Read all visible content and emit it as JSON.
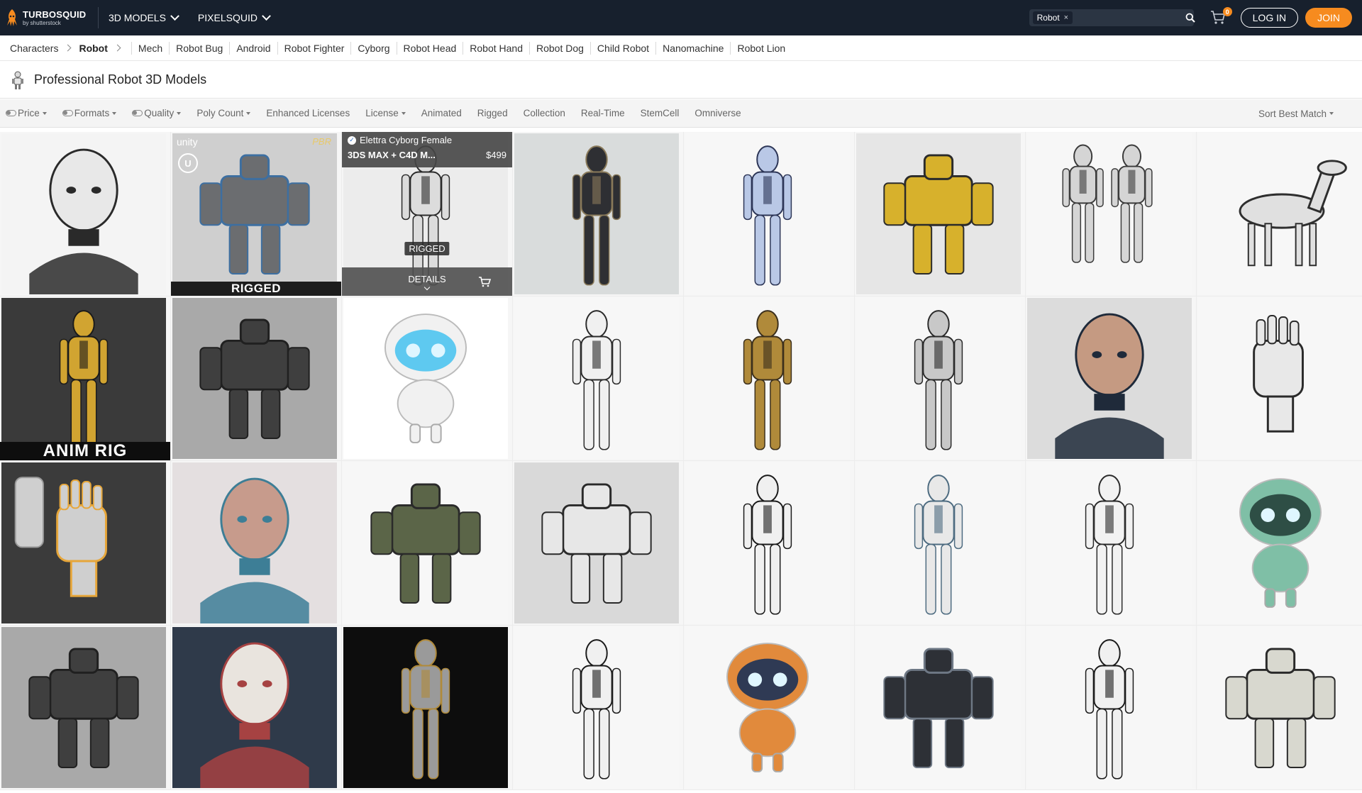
{
  "nav": {
    "logo_name": "TURBOSQUID",
    "logo_sub": "by shutterstock",
    "menus": [
      {
        "label": "3D MODELS"
      },
      {
        "label": "PIXELSQUID"
      }
    ],
    "search_chip": "Robot",
    "search_chip_close": "×",
    "search_placeholder": "",
    "cart_count": "0",
    "login_label": "LOG IN",
    "join_label": "JOIN",
    "colors": {
      "bar": "#17202d",
      "accent": "#f68b1f"
    }
  },
  "breadcrumb": {
    "items": [
      "Characters",
      "Robot"
    ],
    "related": [
      "Mech",
      "Robot Bug",
      "Android",
      "Robot Fighter",
      "Cyborg",
      "Robot Head",
      "Robot Hand",
      "Robot Dog",
      "Child Robot",
      "Nanomachine",
      "Robot Lion"
    ]
  },
  "page": {
    "title": "Professional Robot 3D Models"
  },
  "filters": {
    "items": [
      {
        "label": "Price",
        "toggle": true,
        "dropdown": true
      },
      {
        "label": "Formats",
        "toggle": true,
        "dropdown": true
      },
      {
        "label": "Quality",
        "toggle": true,
        "dropdown": true
      },
      {
        "label": "Poly Count",
        "toggle": false,
        "dropdown": true
      },
      {
        "label": "Enhanced Licenses",
        "toggle": false,
        "dropdown": false
      },
      {
        "label": "License",
        "toggle": false,
        "dropdown": true
      },
      {
        "label": "Animated",
        "toggle": false,
        "dropdown": false
      },
      {
        "label": "Rigged",
        "toggle": false,
        "dropdown": false
      },
      {
        "label": "Collection",
        "toggle": false,
        "dropdown": false
      },
      {
        "label": "Real-Time",
        "toggle": false,
        "dropdown": false
      },
      {
        "label": "StemCell",
        "toggle": false,
        "dropdown": false
      },
      {
        "label": "Omniverse",
        "toggle": false,
        "dropdown": false
      }
    ],
    "sort_label": "Sort Best Match"
  },
  "results": {
    "badges": {
      "rigged": "RIGGED",
      "anim_rig": "ANIM RIG",
      "unity": "unity",
      "pbr": "PBR",
      "unreal": "U"
    },
    "hover_card": {
      "name": "Elettra Cyborg Female",
      "formats": "3DS MAX + C4D M...",
      "price": "$499",
      "rigged": "RIGGED",
      "details": "DETAILS"
    },
    "thumbs": [
      {
        "icon": "white-android-bust",
        "bg": "#f4f4f4",
        "body": "#e8e8e8",
        "accent": "#2a2a2a"
      },
      {
        "icon": "armored-soldier-robot",
        "bg": "#cfcfcf",
        "body": "#6b6d70",
        "accent": "#3d6fa1"
      },
      {
        "icon": "female-cyborg",
        "bg": "#ececec",
        "body": "#dcdcdc",
        "accent": "#2a2a2a"
      },
      {
        "icon": "hooded-ninja-robot",
        "bg": "#d9dcdc",
        "body": "#2e2f33",
        "accent": "#8a7a5a"
      },
      {
        "icon": "blue-female-android",
        "bg": "#f7f7f7",
        "body": "#b9c8e6",
        "accent": "#2c3556"
      },
      {
        "icon": "yellow-combat-robot",
        "bg": "#e6e6e6",
        "body": "#d7b12c",
        "accent": "#2b2b2b"
      },
      {
        "icon": "twin-humanoid-robots",
        "bg": "#f7f7f7",
        "body": "#d5d5d5",
        "accent": "#3a3a3a"
      },
      {
        "icon": "robot-horse",
        "bg": "#f7f7f7",
        "body": "#e0e0e0",
        "accent": "#2e2e2e"
      },
      {
        "icon": "gold-black-robot-collage",
        "bg": "#3a3a3a",
        "body": "#d1a431",
        "accent": "#1b1b1b"
      },
      {
        "icon": "mech-quadruped",
        "bg": "#a9a9a9",
        "body": "#3f3f3f",
        "accent": "#202020"
      },
      {
        "icon": "cute-bubble-robot",
        "bg": "#ffffff",
        "body": "#f1f1f1",
        "accent": "#5ec9f0"
      },
      {
        "icon": "white-female-robot-visor",
        "bg": "#f7f7f7",
        "body": "#f0f0f0",
        "accent": "#2a2a2a"
      },
      {
        "icon": "gold-droid",
        "bg": "#f7f7f7",
        "body": "#b08a3a",
        "accent": "#3b2f1c"
      },
      {
        "icon": "silver-female-android",
        "bg": "#f7f7f7",
        "body": "#c8c8c8",
        "accent": "#2a2a2a"
      },
      {
        "icon": "cyborg-head",
        "bg": "#dcdcdc",
        "body": "#c59a82",
        "accent": "#1f2a3a"
      },
      {
        "icon": "robot-hand",
        "bg": "#f7f7f7",
        "body": "#e8e8e8",
        "accent": "#2a2a2a"
      },
      {
        "icon": "robot-hands-pair",
        "bg": "#3b3b3b",
        "body": "#cfcfcf",
        "accent": "#e6a63a"
      },
      {
        "icon": "cyber-girl-katana",
        "bg": "#e4dfe0",
        "body": "#c79b8c",
        "accent": "#3d7e96"
      },
      {
        "icon": "green-battle-mech",
        "bg": "#f7f7f7",
        "body": "#5b6548",
        "accent": "#2a2a2a"
      },
      {
        "icon": "skull-robot-torso",
        "bg": "#d9d9d9",
        "body": "#e7e7e7",
        "accent": "#2a2a2a"
      },
      {
        "icon": "white-mannequin-robot",
        "bg": "#f7f7f7",
        "body": "#f0f0f0",
        "accent": "#1a1a1a"
      },
      {
        "icon": "blue-grey-mannequin",
        "bg": "#f7f7f7",
        "body": "#e8e8e8",
        "accent": "#4d6b80"
      },
      {
        "icon": "white-helmet-robot",
        "bg": "#f7f7f7",
        "body": "#f2f2f2",
        "accent": "#2a2a2a"
      },
      {
        "icon": "teal-cartoon-robot",
        "bg": "#f7f7f7",
        "body": "#7fbfa6",
        "accent": "#2e4e45"
      },
      {
        "icon": "mech-quadruped-2",
        "bg": "#a9a9a9",
        "body": "#3f3f3f",
        "accent": "#202020"
      },
      {
        "icon": "female-robot-face",
        "bg": "#2f3a4a",
        "body": "#e9e4de",
        "accent": "#a64242"
      },
      {
        "icon": "robot-holding-sphere",
        "bg": "#0d0d0d",
        "body": "#9a9a9a",
        "accent": "#b08a3a"
      },
      {
        "icon": "white-mannequin-robot-2",
        "bg": "#f7f7f7",
        "body": "#f0f0f0",
        "accent": "#1a1a1a"
      },
      {
        "icon": "orange-astronaut-bot",
        "bg": "#f7f7f7",
        "body": "#e18a3c",
        "accent": "#2f3a54"
      },
      {
        "icon": "dark-armored-robot",
        "bg": "#f7f7f7",
        "body": "#2d3036",
        "accent": "#6e7885"
      },
      {
        "icon": "white-mannequin-robot-3",
        "bg": "#f7f7f7",
        "body": "#f0f0f0",
        "accent": "#1a1a1a"
      },
      {
        "icon": "white-armored-trooper",
        "bg": "#f7f7f7",
        "body": "#d8d8cf",
        "accent": "#2a2a2a"
      }
    ]
  }
}
